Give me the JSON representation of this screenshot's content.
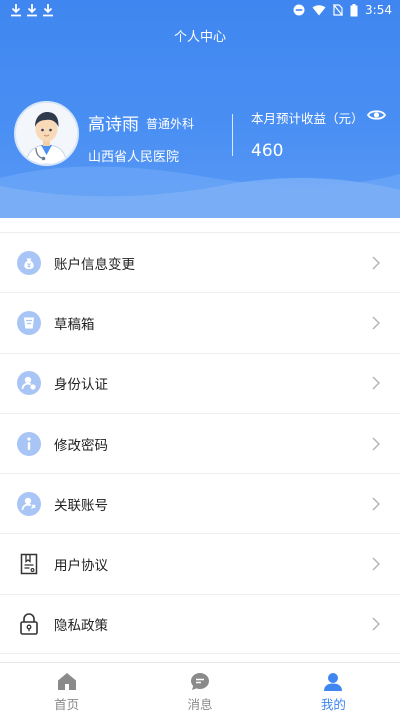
{
  "status_bar": {
    "time": "3:54"
  },
  "header": {
    "title": "个人中心",
    "doctor_name": "高诗雨",
    "department": "普通外科",
    "hospital": "山西省人民医院",
    "income_label": "本月预计收益（元）",
    "income_value": "460"
  },
  "menu": {
    "items": [
      {
        "label": "账户信息变更",
        "icon": "moneybag-icon"
      },
      {
        "label": "草稿箱",
        "icon": "draft-cup-icon"
      },
      {
        "label": "身份认证",
        "icon": "id-verify-icon"
      },
      {
        "label": "修改密码",
        "icon": "info-icon"
      },
      {
        "label": "关联账号",
        "icon": "link-user-icon"
      },
      {
        "label": "用户协议",
        "icon": "agreement-doc-icon"
      },
      {
        "label": "隐私政策",
        "icon": "lock-icon"
      }
    ]
  },
  "tabbar": {
    "tabs": [
      {
        "label": "首页",
        "icon": "home-icon",
        "active": false
      },
      {
        "label": "消息",
        "icon": "message-icon",
        "active": false
      },
      {
        "label": "我的",
        "icon": "person-icon",
        "active": true
      }
    ]
  },
  "colors": {
    "primary": "#3f86f0",
    "icon_bg": "#a8c5f5",
    "text": "#222222",
    "muted": "#8a8a8a"
  }
}
